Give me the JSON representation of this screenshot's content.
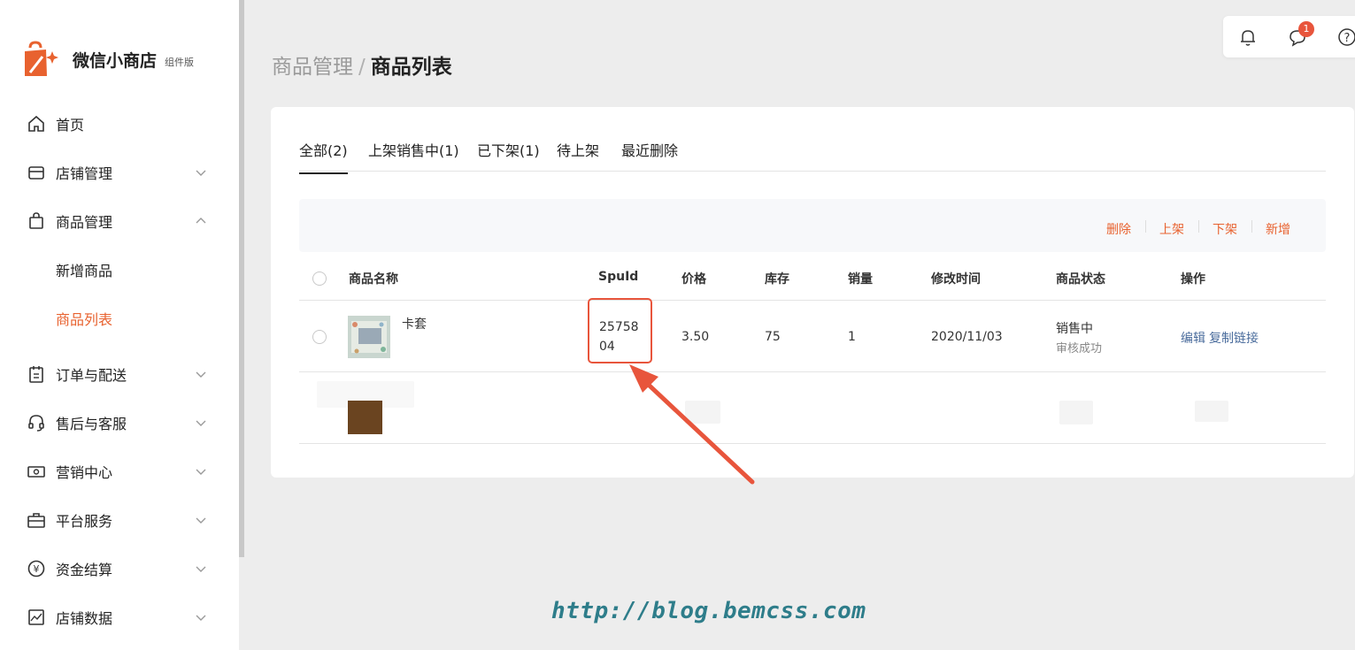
{
  "app": {
    "title": "微信小商店",
    "edition": "组件版"
  },
  "sidebar": {
    "items": [
      {
        "label": "首页",
        "icon": "home-icon"
      },
      {
        "label": "店铺管理",
        "icon": "store-icon"
      },
      {
        "label": "商品管理",
        "icon": "bag-icon"
      },
      {
        "label": "新增商品"
      },
      {
        "label": "商品列表"
      },
      {
        "label": "订单与配送",
        "icon": "clipboard-icon"
      },
      {
        "label": "售后与客服",
        "icon": "headset-icon"
      },
      {
        "label": "营销中心",
        "icon": "ticket-icon"
      },
      {
        "label": "平台服务",
        "icon": "briefcase-icon"
      },
      {
        "label": "资金结算",
        "icon": "yuan-icon"
      },
      {
        "label": "店铺数据",
        "icon": "chart-icon"
      }
    ]
  },
  "topbar": {
    "message_badge": "1"
  },
  "breadcrumb": {
    "parent": "商品管理",
    "separator": "/",
    "current": "商品列表"
  },
  "tabs": [
    "全部(2)",
    "上架销售中(1)",
    "已下架(1)",
    "待上架",
    "最近删除"
  ],
  "toolbar": {
    "delete": "删除",
    "list": "上架",
    "unlist": "下架",
    "add": "新增"
  },
  "table": {
    "headers": [
      "商品名称",
      "SpuId",
      "价格",
      "库存",
      "销量",
      "修改时间",
      "商品状态",
      "操作"
    ],
    "rows": [
      {
        "name": "卡套",
        "spu_id_line1": "25758",
        "spu_id_line2": "04",
        "price": "3.50",
        "stock": "75",
        "sales": "1",
        "modified": "2020/11/03",
        "status": "销售中",
        "review": "审核成功",
        "action_edit": "编辑",
        "action_copy": "复制链接"
      }
    ]
  },
  "watermark": "http://blog.bemcss.com",
  "colors": {
    "accent": "#e8622f",
    "link": "#4a6c9c",
    "highlight": "#e8553c"
  }
}
